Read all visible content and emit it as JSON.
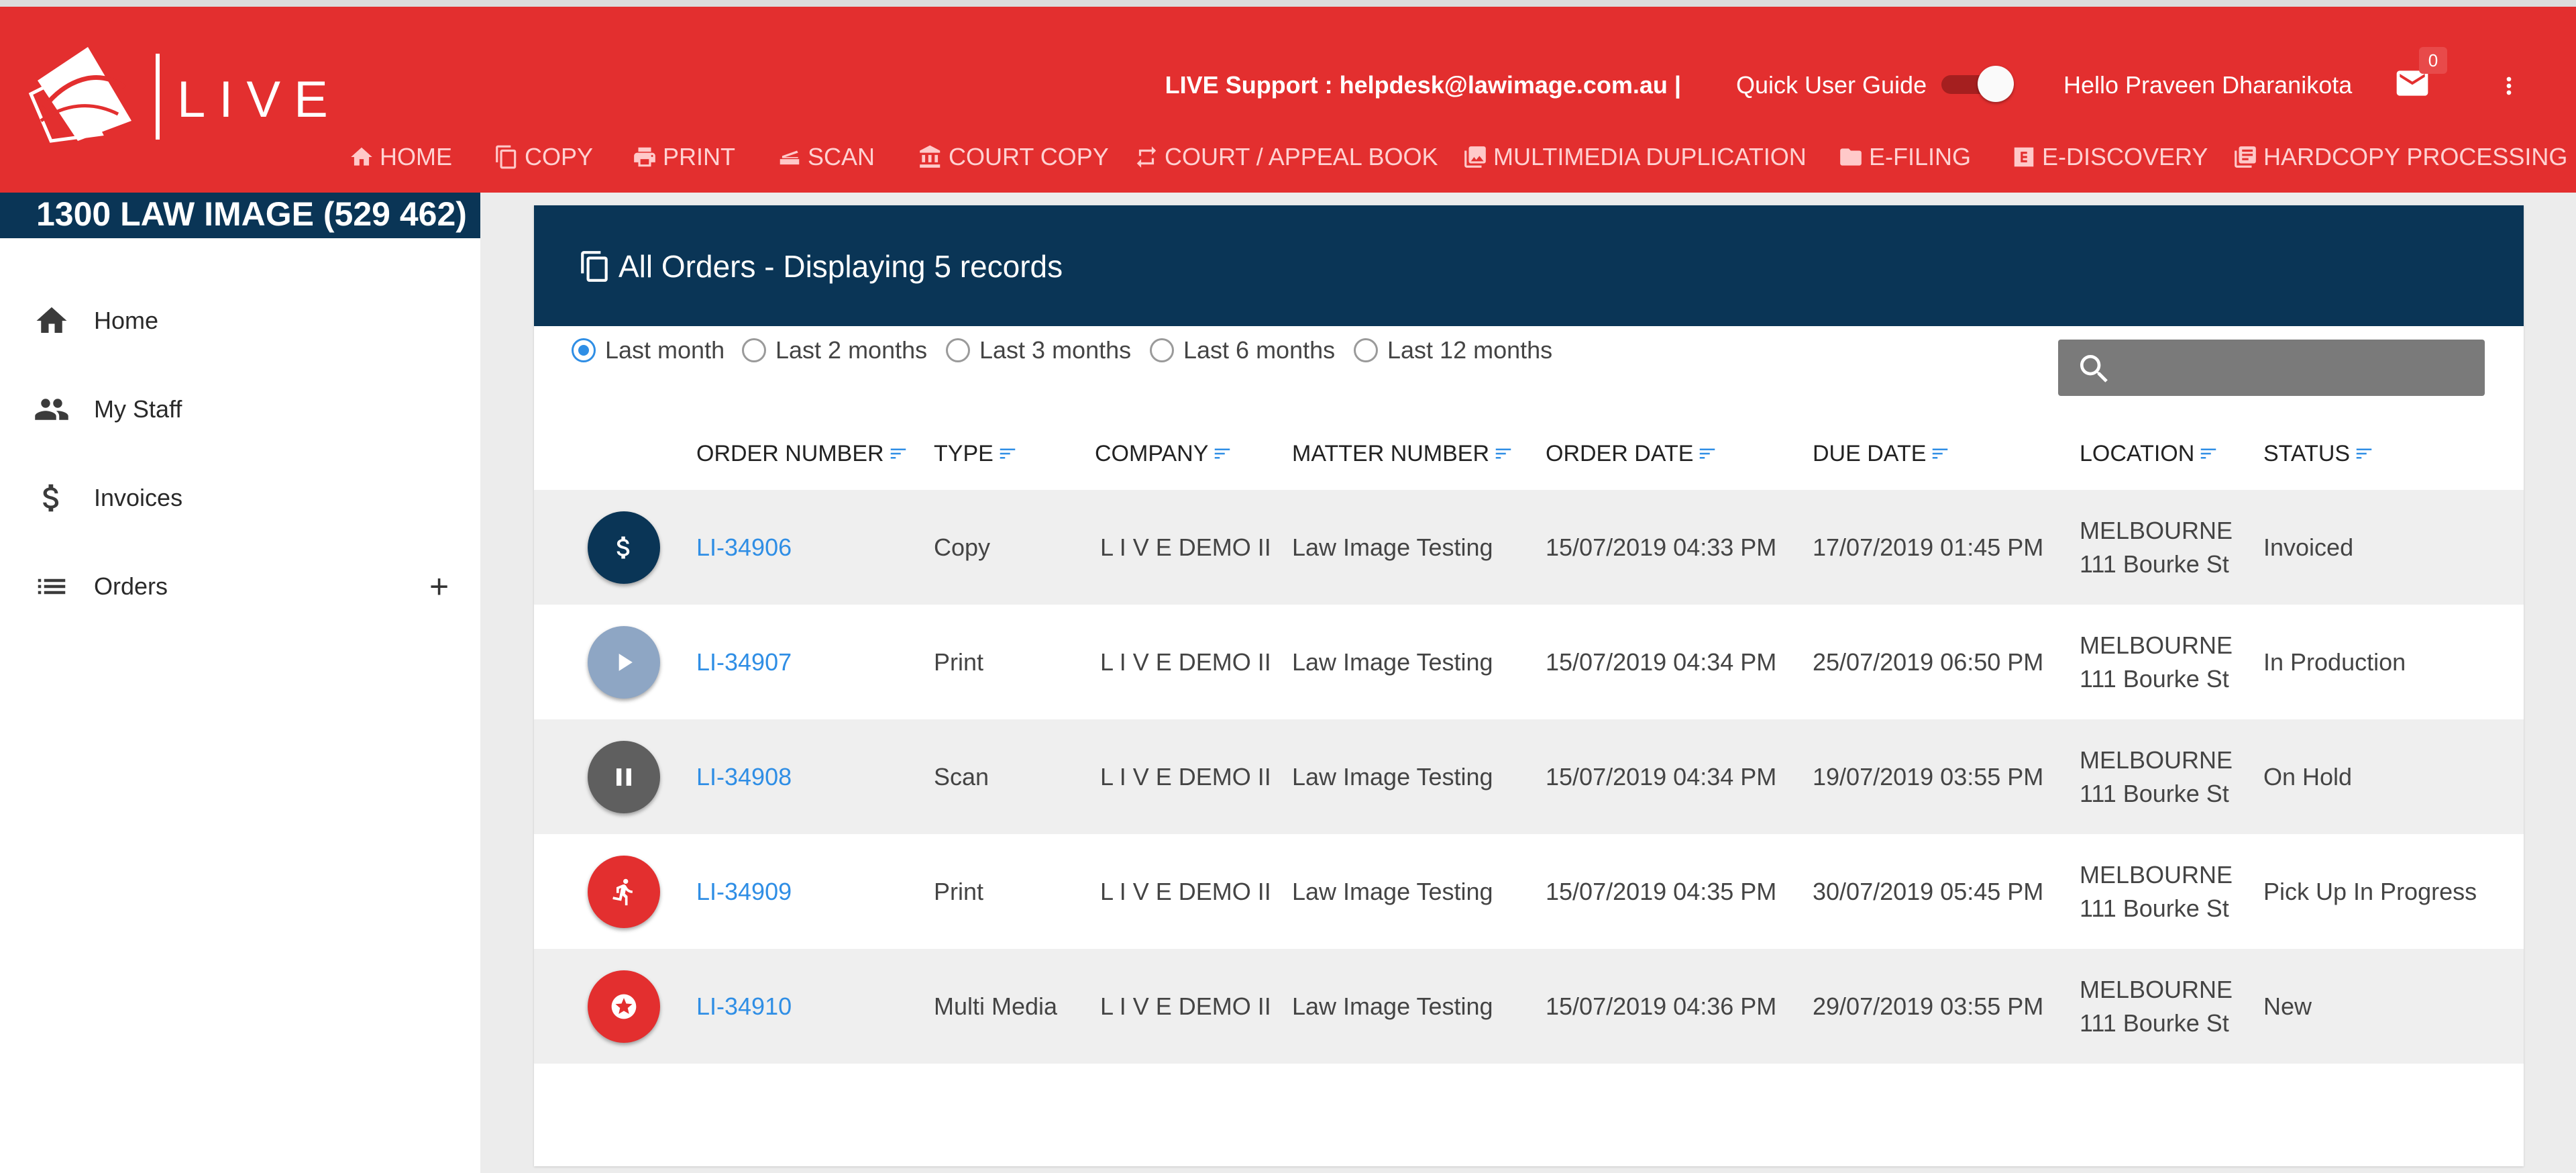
{
  "app": {
    "logo_text": "LIVE",
    "support_text": "LIVE Support : helpdesk@lawimage.com.au |",
    "quick_guide": "Quick User Guide",
    "toggle_on": true,
    "greeting": "Hello Praveen Dharanikota",
    "mail_count": "0"
  },
  "nav": [
    {
      "label": "HOME",
      "icon": "home-icon"
    },
    {
      "label": "COPY",
      "icon": "copy-icon"
    },
    {
      "label": "PRINT",
      "icon": "print-icon"
    },
    {
      "label": "SCAN",
      "icon": "scan-icon"
    },
    {
      "label": "COURT COPY",
      "icon": "court-icon"
    },
    {
      "label": "COURT / APPEAL BOOK",
      "icon": "repeat-icon"
    },
    {
      "label": "MULTIMEDIA DUPLICATION",
      "icon": "photo-icon"
    },
    {
      "label": "E-FILING",
      "icon": "folder-icon"
    },
    {
      "label": "E-DISCOVERY",
      "icon": "e-icon"
    },
    {
      "label": "HARDCOPY PROCESSING",
      "icon": "documents-icon"
    }
  ],
  "sidebar": {
    "phone": "1300 LAW IMAGE (529 462)",
    "items": [
      {
        "label": "Home",
        "icon": "home-icon"
      },
      {
        "label": "My Staff",
        "icon": "people-icon"
      },
      {
        "label": "Invoices",
        "icon": "dollar-icon"
      },
      {
        "label": "Orders",
        "icon": "list-icon",
        "expand": "+"
      }
    ]
  },
  "orders": {
    "title": "All Orders - Displaying 5 records",
    "filters": [
      {
        "label": "Last month",
        "checked": true
      },
      {
        "label": "Last 2 months",
        "checked": false
      },
      {
        "label": "Last 3 months",
        "checked": false
      },
      {
        "label": "Last 6 months",
        "checked": false
      },
      {
        "label": "Last 12 months",
        "checked": false
      }
    ],
    "search_placeholder": "",
    "columns": [
      "ORDER NUMBER",
      "TYPE",
      "COMPANY",
      "MATTER NUMBER",
      "ORDER DATE",
      "DUE DATE",
      "LOCATION",
      "STATUS"
    ],
    "rows": [
      {
        "icon": "dollar-icon",
        "color": "#0a3556",
        "order": "LI-34906",
        "type": "Copy",
        "company": "L I V E DEMO II",
        "matter": "Law Image Testing",
        "order_date": "15/07/2019 04:33 PM",
        "due_date": "17/07/2019 01:45 PM",
        "location_city": "MELBOURNE",
        "location_street": "111 Bourke St",
        "status": "Invoiced"
      },
      {
        "icon": "play-icon",
        "color": "#8ea6c4",
        "order": "LI-34907",
        "type": "Print",
        "company": "L I V E DEMO II",
        "matter": "Law Image Testing",
        "order_date": "15/07/2019 04:34 PM",
        "due_date": "25/07/2019 06:50 PM",
        "location_city": "MELBOURNE",
        "location_street": "111 Bourke St",
        "status": "In Production"
      },
      {
        "icon": "pause-icon",
        "color": "#5f5f5f",
        "order": "LI-34908",
        "type": "Scan",
        "company": "L I V E DEMO II",
        "matter": "Law Image Testing",
        "order_date": "15/07/2019 04:34 PM",
        "due_date": "19/07/2019 03:55 PM",
        "location_city": "MELBOURNE",
        "location_street": "111 Bourke St",
        "status": "On Hold"
      },
      {
        "icon": "running-person-icon",
        "color": "#e32f2f",
        "order": "LI-34909",
        "type": "Print",
        "company": "L I V E DEMO II",
        "matter": "Law Image Testing",
        "order_date": "15/07/2019 04:35 PM",
        "due_date": "30/07/2019 05:45 PM",
        "location_city": "MELBOURNE",
        "location_street": "111 Bourke St",
        "status": "Pick Up In Progress"
      },
      {
        "icon": "star-icon",
        "color": "#e32f2f",
        "order": "LI-34910",
        "type": "Multi Media",
        "company": "L I V E DEMO II",
        "matter": "Law Image Testing",
        "order_date": "15/07/2019 04:36 PM",
        "due_date": "29/07/2019 03:55 PM",
        "location_city": "MELBOURNE",
        "location_street": "111 Bourke St",
        "status": "New"
      }
    ]
  }
}
